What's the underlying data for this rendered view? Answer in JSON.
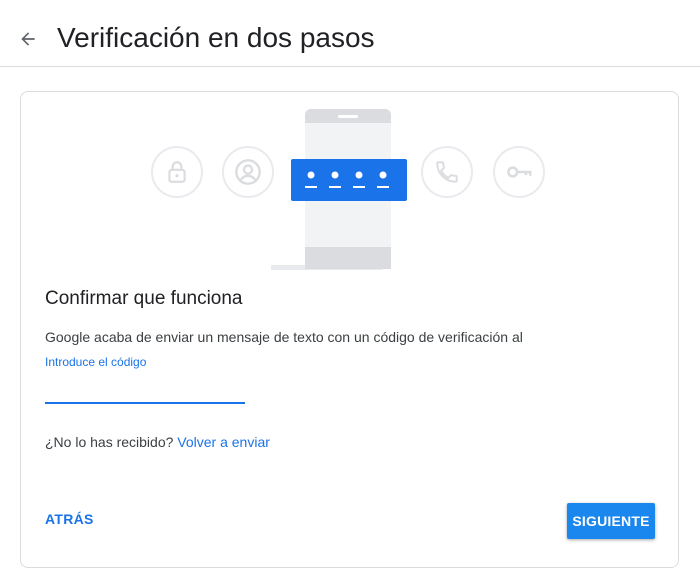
{
  "header": {
    "back_icon": "arrow-back-icon",
    "title": "Verificación en dos pasos"
  },
  "illustration": {
    "icons": [
      "lock-icon",
      "account-circle-icon",
      "phone-with-code-icon",
      "phone-call-icon",
      "key-icon"
    ],
    "accent_color": "#1a73e8"
  },
  "main": {
    "section_title": "Confirmar que funciona",
    "description": "Google acaba de enviar un mensaje de texto con un código de verificación al",
    "code_label": "Introduce el código",
    "code_value": "",
    "resend_prefix": "¿No lo has recibido?",
    "resend_link": "Volver a enviar"
  },
  "actions": {
    "back_label": "ATRÁS",
    "next_label": "SIGUIENTE",
    "primary_color": "#1a87ef"
  }
}
